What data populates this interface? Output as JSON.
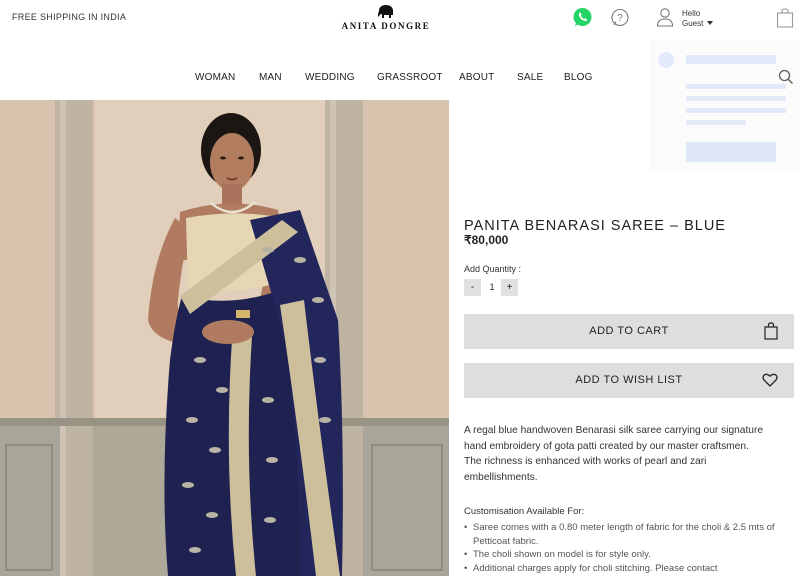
{
  "header": {
    "shipping_text": "FREE SHIPPING IN INDIA",
    "brand": "ANITA DONGRE",
    "greeting_line1": "Hello",
    "greeting_line2": "Guest"
  },
  "nav": {
    "items": [
      {
        "label": "WOMAN"
      },
      {
        "label": "MAN"
      },
      {
        "label": "WEDDING"
      },
      {
        "label": "GRASSROOT"
      },
      {
        "label": "ABOUT"
      },
      {
        "label": "SALE"
      },
      {
        "label": "BLOG"
      }
    ]
  },
  "product": {
    "title": "PANITA BENARASI SAREE – BLUE",
    "price": "₹80,000",
    "quantity_label": "Add Quantity :",
    "quantity_minus": "-",
    "quantity_value": "1",
    "quantity_plus": "+",
    "add_to_cart": "ADD TO CART",
    "add_to_wishlist": "ADD TO WISH LIST",
    "description": "A regal blue handwoven Benarasi silk saree carrying our signature hand embroidery of gota patti created by our master craftsmen. The richness is enhanced with works of pearl and zari embellishments.",
    "customisation_heading": "Customisation Available For:",
    "customisation_items": [
      "Saree comes with a 0.80 meter length of fabric for the choli & 2.5 mts of Petticoat fabric.",
      "The choli shown on model is for style only.",
      "Additional charges apply for choli stitching. Please contact"
    ]
  },
  "colors": {
    "whatsapp": "#25D366",
    "button_bg": "#dedede",
    "saree_blue": "#1f2250",
    "saree_gold": "#cdbf9c"
  }
}
